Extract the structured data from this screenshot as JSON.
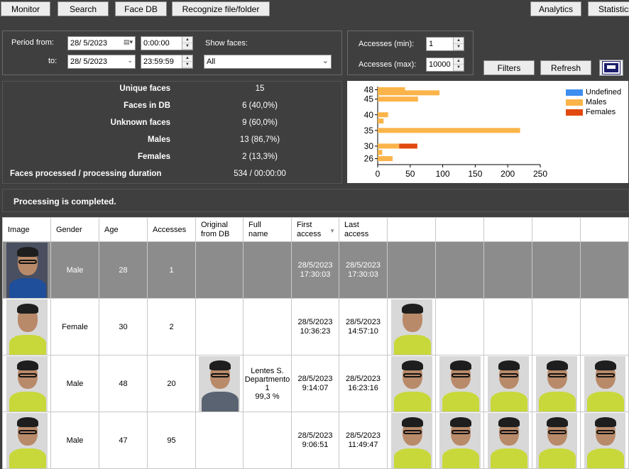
{
  "toolbar": {
    "monitor": "Monitor",
    "search": "Search",
    "face_db": "Face DB",
    "recognize": "Recognize file/folder",
    "analytics": "Analytics",
    "statistics": "Statistics"
  },
  "period": {
    "from_label": "Period from:",
    "to_label": "to:",
    "from_date": "28/ 5/2023",
    "from_time": "0:00:00",
    "to_date": "28/ 5/2023",
    "to_time": "23:59:59",
    "show_faces_label": "Show faces:",
    "show_faces_value": "All"
  },
  "accesses": {
    "min_label": "Accesses (min):",
    "min_value": "1",
    "max_label": "Accesses (max):",
    "max_value": "10000"
  },
  "actions": {
    "filters": "Filters",
    "refresh": "Refresh"
  },
  "stats": {
    "unique_faces_label": "Unique faces",
    "unique_faces": "15",
    "faces_in_db_label": "Faces in DB",
    "faces_in_db": "6 (40,0%)",
    "unknown_faces_label": "Unknown faces",
    "unknown_faces": "9 (60,0%)",
    "males_label": "Males",
    "males": "13 (86,7%)",
    "females_label": "Females",
    "females": "2 (13,3%)",
    "processed_label": "Faces processed / processing duration",
    "processed": "534 / 00:00:00"
  },
  "status": "Processing is completed.",
  "chart_data": {
    "type": "bar",
    "orientation": "horizontal",
    "stacked": true,
    "categories": [
      "26",
      "30",
      "35",
      "40",
      "45",
      "48"
    ],
    "tick_labels_shown": [
      "48",
      "45",
      "40",
      "35",
      "30",
      "26"
    ],
    "rows": [
      {
        "y": 26,
        "Males": 23,
        "Females": 0
      },
      {
        "y": 28,
        "Males": 7,
        "Females": 0
      },
      {
        "y": 30,
        "Males": 33,
        "Females": 28
      },
      {
        "y": 35,
        "Males": 219,
        "Females": 0
      },
      {
        "y": 38,
        "Males": 9,
        "Females": 0
      },
      {
        "y": 40,
        "Males": 16,
        "Females": 0
      },
      {
        "y": 45,
        "Males": 62,
        "Females": 0
      },
      {
        "y": 47,
        "Males": 95,
        "Females": 0
      },
      {
        "y": 48,
        "Males": 42,
        "Females": 0
      }
    ],
    "xlim": [
      0,
      250
    ],
    "xticks": [
      "0",
      "50",
      "100",
      "150",
      "200",
      "250"
    ],
    "legend": [
      {
        "name": "Undefined",
        "color": "#3d8ef0"
      },
      {
        "name": "Males",
        "color": "#fbb44a"
      },
      {
        "name": "Females",
        "color": "#e2490f"
      }
    ],
    "legend_position": "top-right"
  },
  "table": {
    "headers": [
      "Image",
      "Gender",
      "Age",
      "Accesses",
      "Original\nfrom DB",
      "Full\nname",
      "First\naccess",
      "Last\naccess"
    ],
    "rows": [
      {
        "gender": "Male",
        "age": "28",
        "accesses": "1",
        "db_name": "",
        "first": "28/5/2023\n17:30:03",
        "last": "28/5/2023\n17:30:03",
        "thumbs": 0
      },
      {
        "gender": "Female",
        "age": "30",
        "accesses": "2",
        "db_name": "",
        "first": "28/5/2023\n10:36:23",
        "last": "28/5/2023\n14:57:10",
        "thumbs": 1
      },
      {
        "gender": "Male",
        "age": "48",
        "accesses": "20",
        "db_name": "Lentes S.\nDepartmento\n1\n99,3 %",
        "first": "28/5/2023\n9:14:07",
        "last": "28/5/2023\n16:23:16",
        "thumbs": 5
      },
      {
        "gender": "Male",
        "age": "47",
        "accesses": "95",
        "db_name": "",
        "first": "28/5/2023\n9:06:51",
        "last": "28/5/2023\n11:49:47",
        "thumbs": 5
      }
    ]
  }
}
